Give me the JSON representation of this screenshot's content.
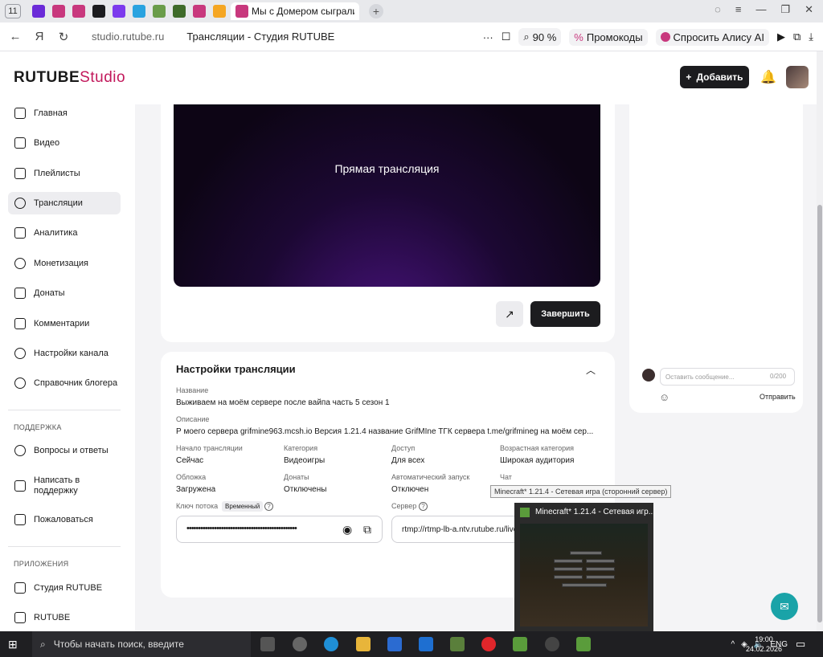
{
  "browser": {
    "tab_counter": "11",
    "active_tab_title": "Мы с Домером сыграли",
    "url": "studio.rutube.ru",
    "page_title": "Трансляции - Студия RUTUBE",
    "zoom": "90 %",
    "promo_label": "Промокоды",
    "alice_label": "Спросить Алису AI"
  },
  "header": {
    "logo_main": "RUTUBE",
    "logo_studio": "Studio",
    "add_label": "Добавить"
  },
  "sidebar": {
    "items": [
      {
        "label": "Главная"
      },
      {
        "label": "Видео"
      },
      {
        "label": "Плейлисты"
      },
      {
        "label": "Трансляции"
      },
      {
        "label": "Аналитика"
      },
      {
        "label": "Монетизация"
      },
      {
        "label": "Донаты"
      },
      {
        "label": "Комментарии"
      },
      {
        "label": "Настройки канала"
      },
      {
        "label": "Справочник блогера"
      }
    ],
    "support_section": "ПОДДЕРЖКА",
    "support_items": [
      {
        "label": "Вопросы и ответы"
      },
      {
        "label": "Написать в поддержку"
      },
      {
        "label": "Пожаловаться"
      }
    ],
    "apps_section": "ПРИЛОЖЕНИЯ",
    "apps_items": [
      {
        "label": "Студия RUTUBE"
      },
      {
        "label": "RUTUBE"
      }
    ]
  },
  "player": {
    "overlay_text": "Прямая трансляция",
    "finish_label": "Завершить"
  },
  "settings": {
    "title": "Настройки трансляции",
    "name_label": "Название",
    "name_value": "Выживаем на моём сервере после вайпа часть 5 сезон 1",
    "desc_label": "Описание",
    "desc_value": "Р моего сервера grifmine963.mcsh.io Версия 1.21.4 название GrifMIne ТГК сервера t.me/grifmineg на моём сер...",
    "start_label": "Начало трансляции",
    "start_value": "Сейчас",
    "category_label": "Категория",
    "category_value": "Видеоигры",
    "access_label": "Доступ",
    "access_value": "Для всех",
    "age_label": "Возрастная категория",
    "age_value": "Широкая аудитория",
    "cover_label": "Обложка",
    "cover_value": "Загружена",
    "donations_label": "Донаты",
    "donations_value": "Отключены",
    "autostart_label": "Автоматический запуск",
    "autostart_value": "Отключен",
    "chat_label": "Чат",
    "key_label": "Ключ потока",
    "key_badge": "Временный",
    "key_value": "••••••••••••••••••••••••••••••••••••••••••••••••",
    "server_label": "Сервер",
    "server_value": "rtmp://rtmp-lb-a.ntv.rutube.ru/live"
  },
  "chat": {
    "placeholder": "Оставить сообщение...",
    "count": "0/200",
    "send_label": "Отправить"
  },
  "taskbar_preview": {
    "tooltip": "Minecraft* 1.21.4 - Сетевая игра (сторонний сервер)",
    "title": "Minecraft* 1.21.4 - Сетевая игр..."
  },
  "taskbar": {
    "search_placeholder": "Чтобы начать поиск, введите",
    "lang": "ENG",
    "time": "19:00",
    "date": "24.02.2026"
  }
}
